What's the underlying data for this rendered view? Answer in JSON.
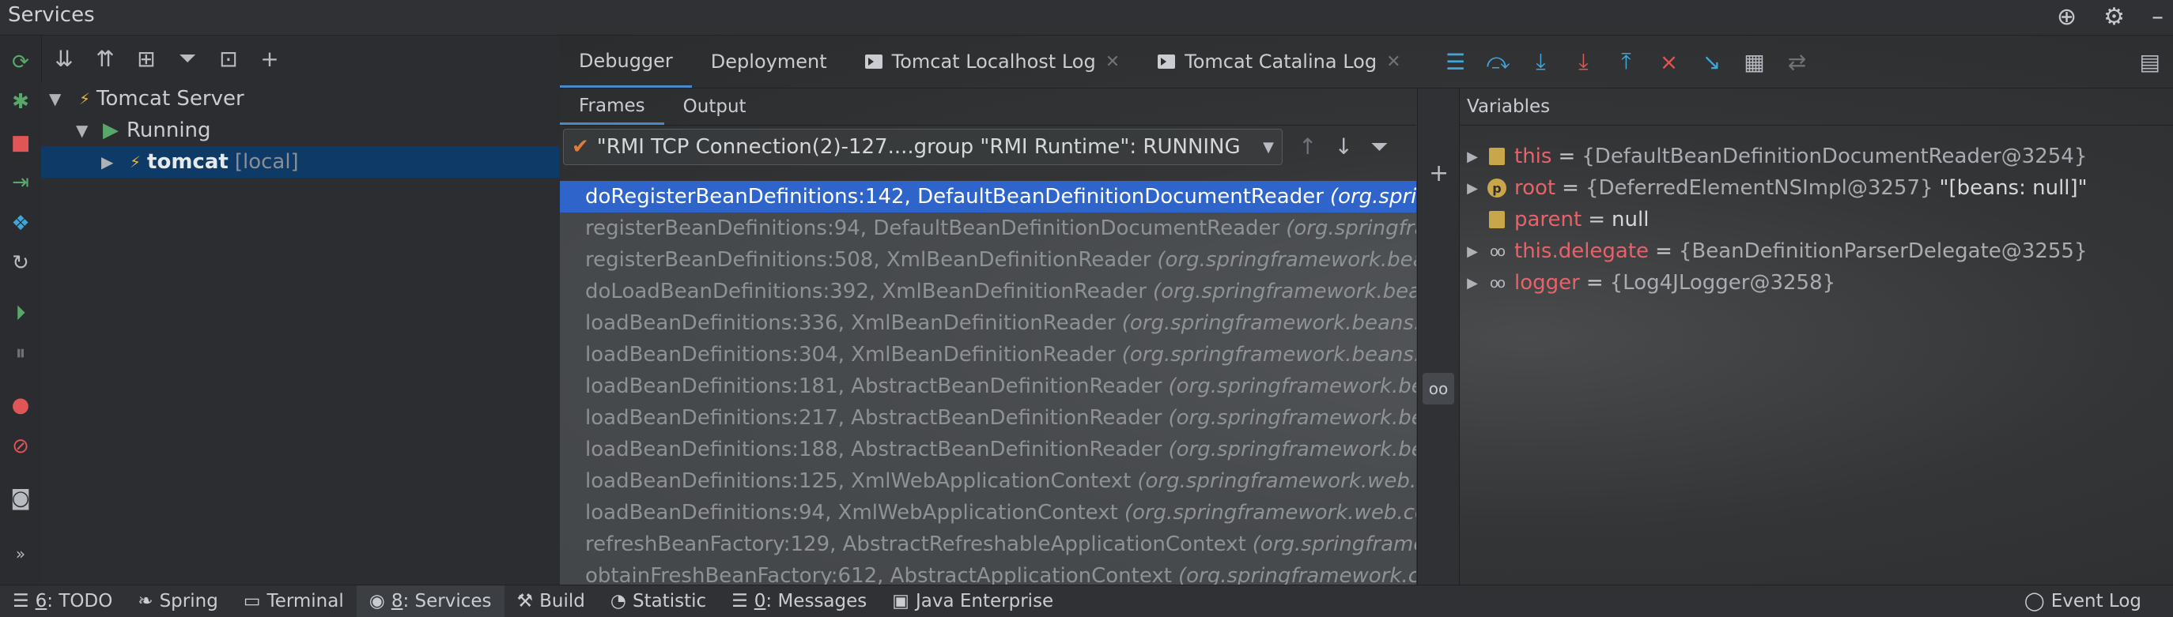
{
  "window": {
    "title": "Services"
  },
  "tree": {
    "server": "Tomcat Server",
    "running": "Running",
    "node_name": "tomcat",
    "node_suffix": "[local]"
  },
  "debugger": {
    "tabs": [
      "Debugger",
      "Deployment",
      "Tomcat Localhost Log",
      "Tomcat Catalina Log"
    ],
    "subtabs": [
      "Frames",
      "Output"
    ],
    "thread": "\"RMI TCP Connection(2)-127....group \"RMI Runtime\": RUNNING",
    "frames": [
      {
        "method": "doRegisterBeanDefinitions:142, DefaultBeanDefinitionDocumentReader",
        "pkg": "(org.springframework.beans.factory.xml)"
      },
      {
        "method": "registerBeanDefinitions:94, DefaultBeanDefinitionDocumentReader",
        "pkg": "(org.springframework.beans.factory.xml)"
      },
      {
        "method": "registerBeanDefinitions:508, XmlBeanDefinitionReader",
        "pkg": "(org.springframework.beans.factory.xml)"
      },
      {
        "method": "doLoadBeanDefinitions:392, XmlBeanDefinitionReader",
        "pkg": "(org.springframework.beans.factory.xml)"
      },
      {
        "method": "loadBeanDefinitions:336, XmlBeanDefinitionReader",
        "pkg": "(org.springframework.beans.factory.xml)"
      },
      {
        "method": "loadBeanDefinitions:304, XmlBeanDefinitionReader",
        "pkg": "(org.springframework.beans.factory.xml)"
      },
      {
        "method": "loadBeanDefinitions:181, AbstractBeanDefinitionReader",
        "pkg": "(org.springframework.beans.factory.support)"
      },
      {
        "method": "loadBeanDefinitions:217, AbstractBeanDefinitionReader",
        "pkg": "(org.springframework.beans.factory.support)"
      },
      {
        "method": "loadBeanDefinitions:188, AbstractBeanDefinitionReader",
        "pkg": "(org.springframework.beans.factory.support)"
      },
      {
        "method": "loadBeanDefinitions:125, XmlWebApplicationContext",
        "pkg": "(org.springframework.web.context.support)"
      },
      {
        "method": "loadBeanDefinitions:94, XmlWebApplicationContext",
        "pkg": "(org.springframework.web.context.support)"
      },
      {
        "method": "refreshBeanFactory:129, AbstractRefreshableApplicationContext",
        "pkg": "(org.springframework.context.support)"
      },
      {
        "method": "obtainFreshBeanFactory:612, AbstractApplicationContext",
        "pkg": "(org.springframework.context.support)"
      }
    ],
    "variables_header": "Variables",
    "variables": [
      {
        "name": "this",
        "eq": "=",
        "value": "{DefaultBeanDefinitionDocumentReader@3254}",
        "extra": "",
        "icon": "field-icon",
        "expandable": true
      },
      {
        "name": "root",
        "eq": "=",
        "value": "{DeferredElementNSImpl@3257}",
        "extra": "\"[beans: null]\"",
        "icon": "parameter-icon",
        "expandable": true
      },
      {
        "name": "parent",
        "eq": "=",
        "value": "null",
        "extra": "",
        "icon": "field-icon",
        "expandable": false
      },
      {
        "name": "this.delegate",
        "eq": "=",
        "value": "{BeanDefinitionParserDelegate@3255}",
        "extra": "",
        "icon": "watch-icon",
        "expandable": true
      },
      {
        "name": "logger",
        "eq": "=",
        "value": "{Log4JLogger@3258}",
        "extra": "",
        "icon": "watch-icon",
        "expandable": true
      }
    ]
  },
  "statusbar": {
    "items": [
      {
        "num": "6",
        "label": ": TODO",
        "icon": "list-icon"
      },
      {
        "num": "",
        "label": "Spring",
        "icon": "leaf-icon"
      },
      {
        "num": "",
        "label": "Terminal",
        "icon": "terminal-icon"
      },
      {
        "num": "8",
        "label": ": Services",
        "icon": "services-icon",
        "active": true
      },
      {
        "num": "",
        "label": "Build",
        "icon": "hammer-icon"
      },
      {
        "num": "",
        "label": "Statistic",
        "icon": "statistic-icon"
      },
      {
        "num": "0",
        "label": ": Messages",
        "icon": "messages-icon"
      },
      {
        "num": "",
        "label": "Java Enterprise",
        "icon": "enterprise-icon"
      }
    ],
    "event_log": "Event Log"
  },
  "colors": {
    "accent_blue": "#2f65ca",
    "var_name": "#e8626b",
    "check": "#e07b39"
  }
}
